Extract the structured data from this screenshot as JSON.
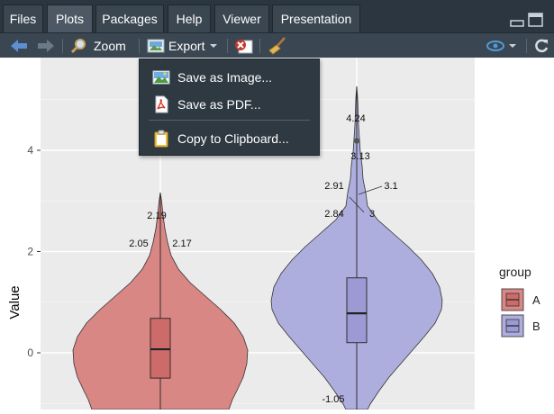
{
  "tabs": [
    {
      "label": "Files",
      "active": false
    },
    {
      "label": "Plots",
      "active": true
    },
    {
      "label": "Packages",
      "active": false
    },
    {
      "label": "Help",
      "active": false
    },
    {
      "label": "Viewer",
      "active": false
    },
    {
      "label": "Presentation",
      "active": false
    }
  ],
  "toolbar": {
    "zoom_label": "Zoom",
    "export_label": "Export"
  },
  "export_menu": {
    "items": [
      {
        "label": "Save as Image...",
        "icon": "image-icon"
      },
      {
        "label": "Save as PDF...",
        "icon": "pdf-icon"
      },
      {
        "label": "Copy to Clipboard...",
        "icon": "clipboard-icon"
      }
    ]
  },
  "colors": {
    "group_a": "#d98785",
    "group_b": "#aeaede",
    "panel": "#ebebeb",
    "box_a": "#cc6b69",
    "box_b": "#9b9ad4"
  },
  "chart_data": {
    "type": "violin",
    "ylabel": "Value",
    "yticks": [
      0,
      2,
      4
    ],
    "legend": {
      "title": "group",
      "entries": [
        "A",
        "B"
      ],
      "position": "right"
    },
    "series": [
      {
        "name": "A",
        "box": {
          "q1": -0.5,
          "median": 0.07,
          "q3": 0.68
        },
        "labels": [
          {
            "text": "2.19",
            "value": 2.19
          },
          {
            "text": "2.05",
            "value": 2.05
          },
          {
            "text": "2.17",
            "value": 2.17
          }
        ]
      },
      {
        "name": "B",
        "box": {
          "q1": 0.2,
          "median": 0.78,
          "q3": 1.48
        },
        "outliers": [
          4.24
        ],
        "labels": [
          {
            "text": "4.24",
            "value": 4.24
          },
          {
            "text": "3.13",
            "value": 3.13
          },
          {
            "text": "2.91",
            "value": 2.91
          },
          {
            "text": "3.1",
            "value": 3.1
          },
          {
            "text": "2.84",
            "value": 2.84
          },
          {
            "text": "3",
            "value": 3
          },
          {
            "text": "-1.05",
            "value": -1.05
          }
        ]
      }
    ],
    "ylim": [
      -1.1,
      5.5
    ],
    "grid": true
  }
}
